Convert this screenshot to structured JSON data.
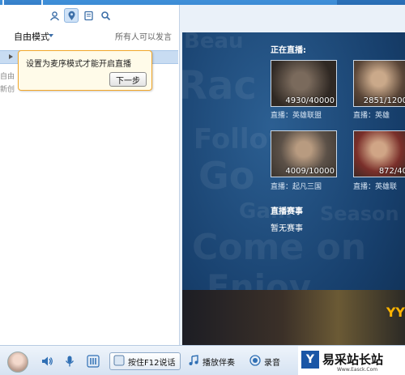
{
  "left": {
    "mode_label": "自由模式",
    "mode_right": "所有人可以发言",
    "side_text": [
      "自由",
      "新创"
    ],
    "tooltip_text": "设置为麦序模式才能开启直播",
    "next_button": "下一步"
  },
  "live": {
    "section_title": "正在直播:",
    "items": [
      {
        "count": "4930/40000",
        "caption": "直播：英雄联盟"
      },
      {
        "count": "2851/1200",
        "caption": "直播：英雄"
      },
      {
        "count": "4009/10000",
        "caption": "直播：起凡三国"
      },
      {
        "count": "872/40",
        "caption": "直播：英雄联"
      }
    ],
    "events_title": "直播赛事",
    "no_events": "暂无赛事",
    "banner_text": "YY",
    "bg_words": [
      "Beau",
      "Rac",
      "Follow",
      "Go",
      "Gam",
      "Season",
      "Come on",
      "Enjoy"
    ]
  },
  "bottom": {
    "f12_label": "按住F12说话",
    "music_label": "播放伴奏",
    "record_label": "录音"
  },
  "watermark": {
    "logo": "Y",
    "name": "易采站长站",
    "url": "Www.Easck.Com"
  },
  "colors": {
    "accent": "#2f7cc8",
    "tooltip_border": "#f2a72a",
    "live_bg": "#173f6c"
  }
}
